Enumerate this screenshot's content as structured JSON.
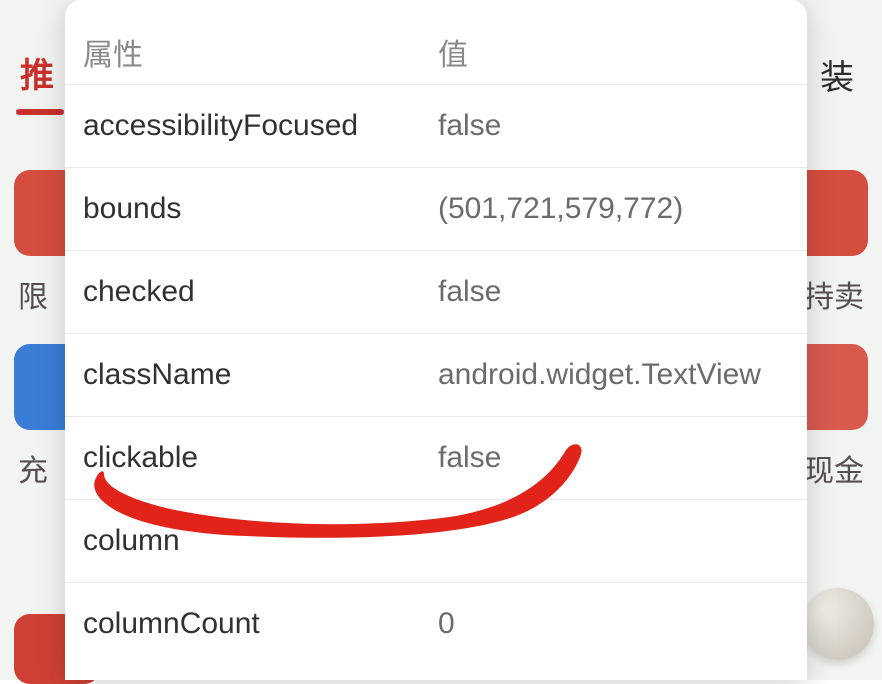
{
  "background": {
    "tab_left": "推",
    "tab_right": "装",
    "label_left_1": "限",
    "label_right_1": "持卖",
    "label_left_2": "充",
    "label_right_2": "现金",
    "card_colors": {
      "top_left": "#d54d3e",
      "top_right": "#d54d3e",
      "mid_left": "#3a7cd6",
      "mid_right": "#d85a4f",
      "bottom_left": "#cf4034"
    }
  },
  "dialog": {
    "header": {
      "attr": "属性",
      "val": "值"
    },
    "rows": [
      {
        "attr": "accessibilityFocused",
        "val": "false"
      },
      {
        "attr": "bounds",
        "val": "(501,721,579,772)"
      },
      {
        "attr": "checked",
        "val": "false"
      },
      {
        "attr": "className",
        "val": "android.widget.TextView"
      },
      {
        "attr": "clickable",
        "val": "false"
      },
      {
        "attr": "column",
        "val": ""
      },
      {
        "attr": "columnCount",
        "val": "0"
      }
    ]
  },
  "annotation": {
    "stroke": "#e2231a"
  }
}
